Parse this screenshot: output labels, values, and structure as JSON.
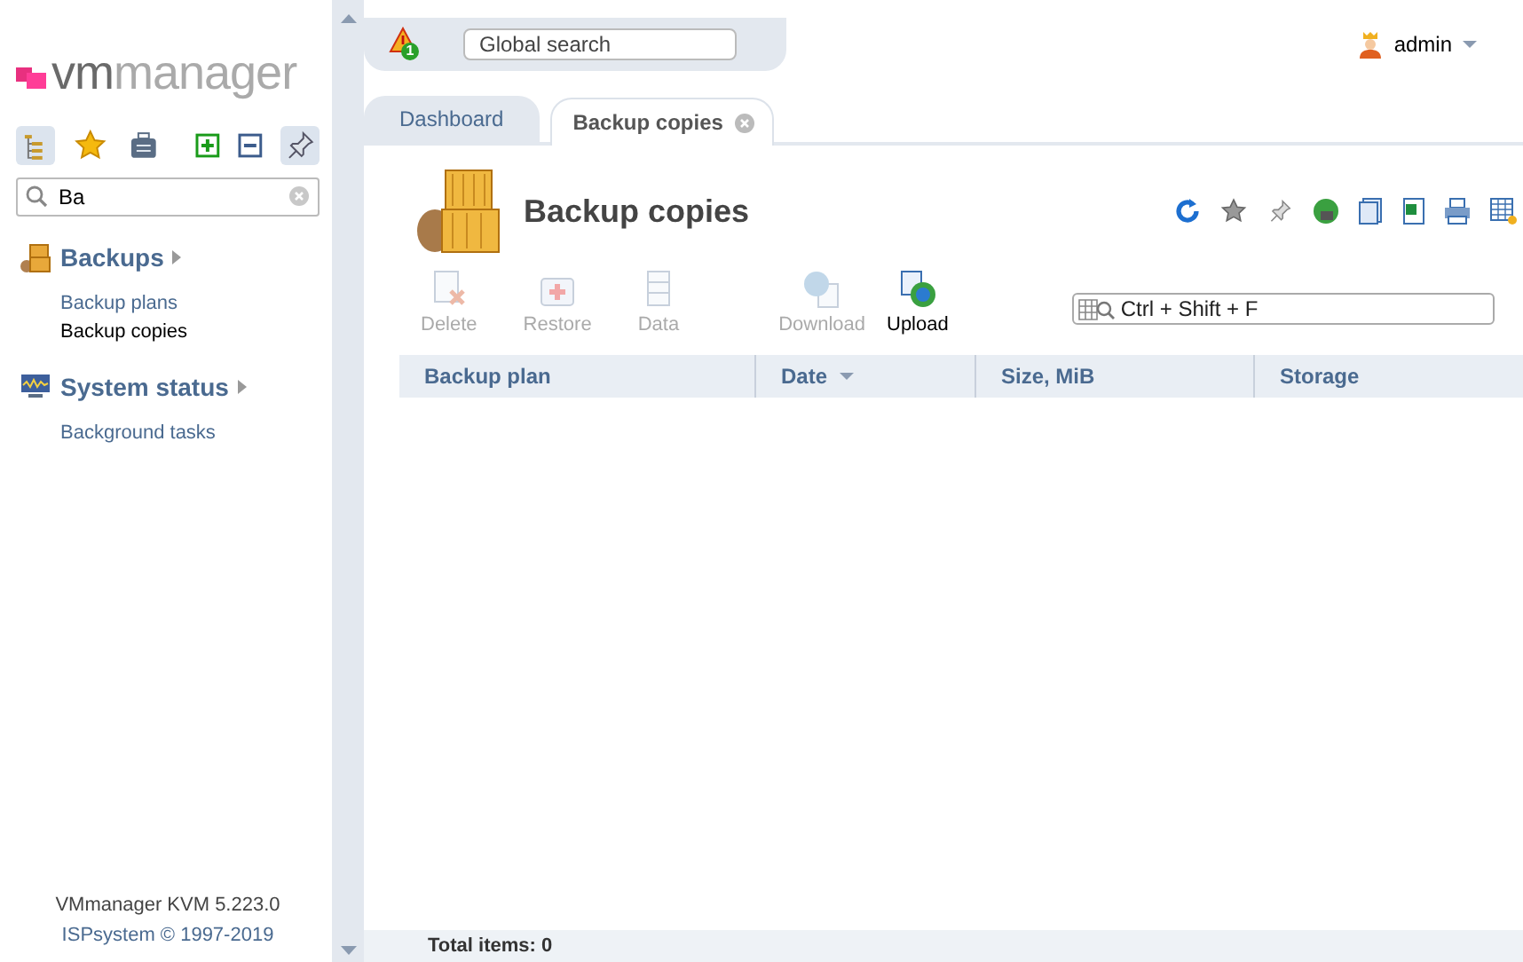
{
  "logo": {
    "part_1": "vm",
    "part_2": "manager"
  },
  "sidebar": {
    "search": {
      "value": "Ba"
    },
    "groups": [
      {
        "title": "Backups",
        "kind": "backup",
        "items": [
          {
            "label": "Backup plans",
            "selected": false
          },
          {
            "label": "Backup copies",
            "selected": true
          }
        ]
      },
      {
        "title": "System status",
        "kind": "monitor",
        "items": [
          {
            "label": "Background tasks",
            "selected": false
          }
        ]
      }
    ],
    "footer": {
      "version": "VMmanager KVM 5.223.0",
      "copyright": "ISPsystem © 1997-2019"
    }
  },
  "topbar": {
    "alert_count": "1",
    "search": {
      "placeholder": "Global search"
    },
    "user": "admin"
  },
  "tabs": [
    {
      "label": "Dashboard",
      "selected": false,
      "closable": false
    },
    {
      "label": "Backup copies",
      "selected": true,
      "closable": true
    }
  ],
  "page": {
    "title": "Backup copies",
    "toolbar": [
      {
        "label": "Delete",
        "kind": "delete",
        "disabled": true
      },
      {
        "label": "Restore",
        "kind": "restore",
        "disabled": true
      },
      {
        "label": "Data",
        "kind": "data",
        "disabled": true
      },
      {
        "label": "Download",
        "kind": "download",
        "disabled": true
      },
      {
        "label": "Upload",
        "kind": "upload",
        "disabled": false
      }
    ],
    "filter": {
      "placeholder": "Ctrl + Shift + F"
    },
    "table": {
      "columns": [
        {
          "label": "Backup plan",
          "sorted": false
        },
        {
          "label": "Date",
          "sorted": true
        },
        {
          "label": "Size, MiB",
          "sorted": false
        },
        {
          "label": "Storage",
          "sorted": false
        }
      ]
    },
    "total": "Total items: 0"
  }
}
